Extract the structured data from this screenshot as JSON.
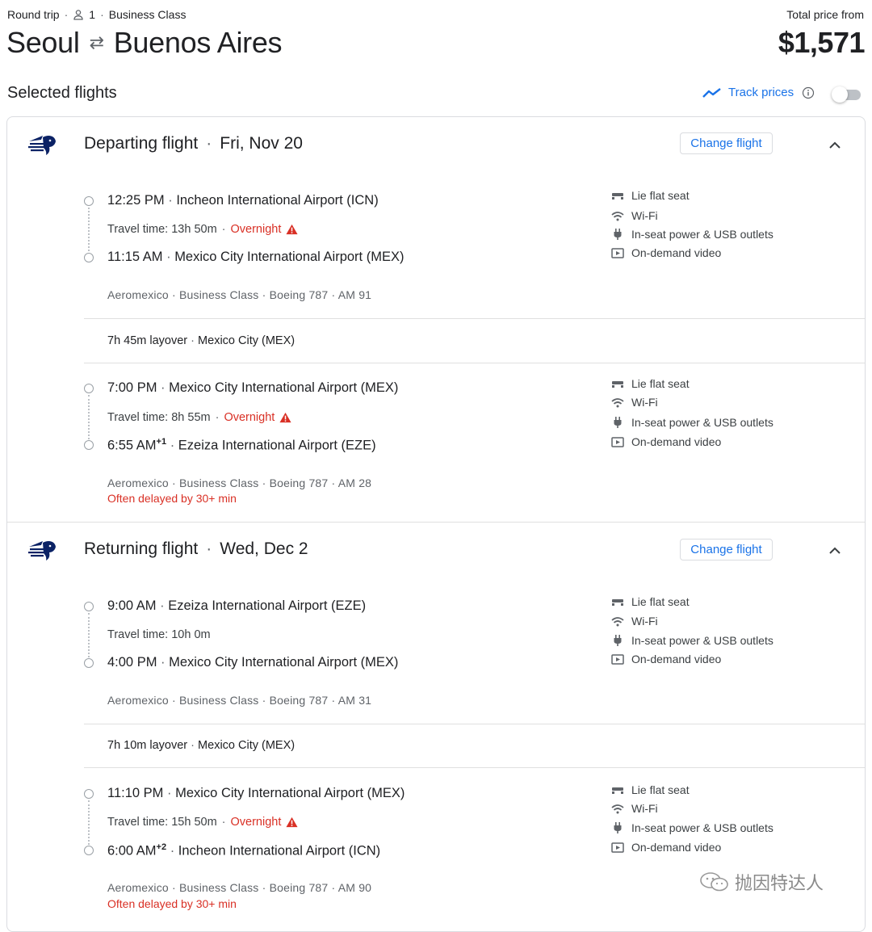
{
  "header": {
    "trip_type": "Round trip",
    "passengers": "1",
    "cabin": "Business Class",
    "origin": "Seoul",
    "destination": "Buenos Aires",
    "price_label": "Total price from",
    "price": "$1,571"
  },
  "selected": {
    "title": "Selected flights",
    "track_label": "Track prices",
    "track_enabled": false
  },
  "departing": {
    "label": "Departing flight",
    "date": "Fri, Nov 20",
    "change_label": "Change flight",
    "segments": [
      {
        "dep_time": "12:25 PM",
        "dep_airport": "Incheon International Airport (ICN)",
        "travel_time": "Travel time: 13h 50m",
        "overnight": "Overnight",
        "arr_time": "11:15 AM",
        "arr_suffix": "",
        "arr_airport": "Mexico City International Airport (MEX)",
        "airline": "Aeromexico",
        "cabin": "Business Class",
        "aircraft": "Boeing 787",
        "flight_no": "AM 91",
        "delay": ""
      },
      {
        "dep_time": "7:00 PM",
        "dep_airport": "Mexico City International Airport (MEX)",
        "travel_time": "Travel time: 8h 55m",
        "overnight": "Overnight",
        "arr_time": "6:55 AM",
        "arr_suffix": "+1",
        "arr_airport": "Ezeiza International Airport (EZE)",
        "airline": "Aeromexico",
        "cabin": "Business Class",
        "aircraft": "Boeing 787",
        "flight_no": "AM 28",
        "delay": "Often delayed by 30+ min"
      }
    ],
    "layover": {
      "duration": "7h 45m layover",
      "place": "Mexico City (MEX)"
    }
  },
  "returning": {
    "label": "Returning flight",
    "date": "Wed, Dec 2",
    "change_label": "Change flight",
    "segments": [
      {
        "dep_time": "9:00 AM",
        "dep_airport": "Ezeiza International Airport (EZE)",
        "travel_time": "Travel time: 10h 0m",
        "overnight": "",
        "arr_time": "4:00 PM",
        "arr_suffix": "",
        "arr_airport": "Mexico City International Airport (MEX)",
        "airline": "Aeromexico",
        "cabin": "Business Class",
        "aircraft": "Boeing 787",
        "flight_no": "AM 31",
        "delay": ""
      },
      {
        "dep_time": "11:10 PM",
        "dep_airport": "Mexico City International Airport (MEX)",
        "travel_time": "Travel time: 15h 50m",
        "overnight": "Overnight",
        "arr_time": "6:00 AM",
        "arr_suffix": "+2",
        "arr_airport": "Incheon International Airport (ICN)",
        "airline": "Aeromexico",
        "cabin": "Business Class",
        "aircraft": "Boeing 787",
        "flight_no": "AM 90",
        "delay": "Often delayed by 30+ min"
      }
    ],
    "layover": {
      "duration": "7h 10m layover",
      "place": "Mexico City (MEX)"
    }
  },
  "amenities": [
    "Lie flat seat",
    "Wi-Fi",
    "In-seat power & USB outlets",
    "On-demand video"
  ],
  "amenity_icons": [
    "seat-icon",
    "wifi-icon",
    "power-plug-icon",
    "video-icon"
  ],
  "separator": "·",
  "watermark": "抛因特达人",
  "colors": {
    "accent": "#1a73e8",
    "warning": "#d93025",
    "text": "#202124",
    "muted": "#5f6368",
    "logo": "#0b2265"
  }
}
